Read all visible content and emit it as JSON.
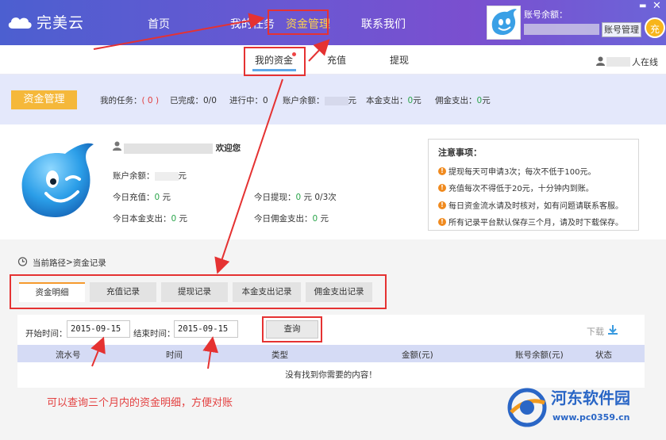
{
  "app": {
    "logo_text": "完美云"
  },
  "nav": {
    "items": [
      {
        "label": "首页"
      },
      {
        "label": "我的任务"
      },
      {
        "label": "资金管理"
      },
      {
        "label": "联系我们"
      }
    ]
  },
  "user_panel": {
    "balance_label": "账号余额：",
    "account_button": "账号管理",
    "fill_badge": "充"
  },
  "subnav": {
    "items": [
      {
        "label": "我的资金"
      },
      {
        "label": "充值"
      },
      {
        "label": "提现"
      }
    ],
    "online_suffix": "人在线"
  },
  "summary": {
    "tag": "资金管理",
    "my_tasks_label": "我的任务：",
    "my_tasks_value": "( 0 )",
    "completed_label": "已完成：",
    "completed_value": "0/0",
    "in_progress_label": "进行中：",
    "in_progress_value": "0",
    "balance_label": "账户余额：",
    "balance_unit": "元",
    "principal_label": "本金支出：",
    "principal_value": "0",
    "principal_unit": "元",
    "commission_label": "佣金支出：",
    "commission_value": "0",
    "commission_unit": "元"
  },
  "profile": {
    "welcome": "欢迎您",
    "balance_label": "账户余额：",
    "balance_unit": "元",
    "today_recharge_label": "今日充值：",
    "today_recharge_value": "0",
    "today_recharge_unit": " 元",
    "today_withdraw_label": "今日提现：",
    "today_withdraw_value": "0",
    "today_withdraw_extra": " 元 0/3次",
    "today_principal_label": "今日本金支出：",
    "today_principal_value": "0",
    "today_principal_unit": " 元",
    "today_commission_label": "今日佣金支出：",
    "today_commission_value": "0",
    "today_commission_unit": " 元"
  },
  "notes": {
    "title": "注意事项：",
    "items": [
      "提现每天可申请3次；每次不低于100元。",
      "充值每次不得低于20元，十分钟内到账。",
      "每日资金流水请及时核对，如有问题请联系客服。",
      "所有记录平台默认保存三个月，请及时下载保存。"
    ]
  },
  "breadcrumb": {
    "label": "当前路径",
    "sep": " > ",
    "current": "资金记录"
  },
  "tabs": [
    {
      "label": "资金明细"
    },
    {
      "label": "充值记录"
    },
    {
      "label": "提现记录"
    },
    {
      "label": "本金支出记录"
    },
    {
      "label": "佣金支出记录"
    }
  ],
  "filter": {
    "start_label": "开始时间：",
    "start_value": "2015-09-15",
    "end_label": "结束时间：",
    "end_value": "2015-09-15",
    "query_button": "查询",
    "download_label": "下载"
  },
  "table": {
    "columns": [
      "流水号",
      "时间",
      "类型",
      "金额(元)",
      "账号余额(元)",
      "状态"
    ],
    "empty_message": "没有找到你需要的内容！"
  },
  "annotation": "可以查询三个月内的资金明细，方便对账",
  "watermark": {
    "name": "河东软件园",
    "url": "www.pc0359.cn"
  },
  "colors": {
    "accent": "#ffd34a",
    "highlight": "#e53232",
    "tag": "#f5b83a",
    "green": "#2aa54a"
  }
}
